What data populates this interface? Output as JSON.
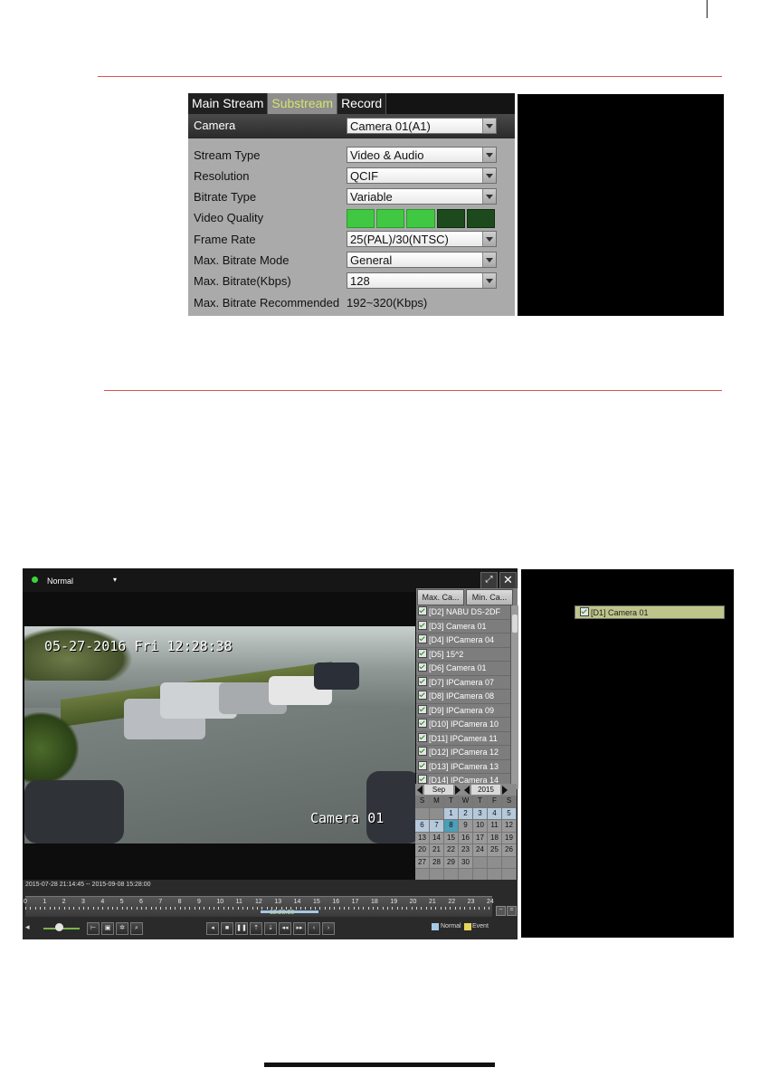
{
  "substream": {
    "tabs": [
      "Main Stream",
      "Substream",
      "Record"
    ],
    "active_tab": "Substream",
    "camera_label": "Camera",
    "camera_value": "Camera 01(A1)",
    "fields": [
      {
        "label": "Stream Type",
        "value": "Video & Audio"
      },
      {
        "label": "Resolution",
        "value": "QCIF"
      },
      {
        "label": "Bitrate Type",
        "value": "Variable"
      },
      {
        "label": "Frame Rate",
        "value": "25(PAL)/30(NTSC)"
      },
      {
        "label": "Max. Bitrate Mode",
        "value": "General"
      },
      {
        "label": "Max. Bitrate(Kbps)",
        "value": "128"
      }
    ],
    "video_quality_label": "Video Quality",
    "video_quality_level": 3,
    "video_quality_max": 5,
    "recommended_label": "Max. Bitrate Recommended",
    "recommended_value": "192~320(Kbps)"
  },
  "playback": {
    "mode": "Normal",
    "osd_datetime": "05-27-2016 Fri 12:28:38",
    "osd_camera": "Camera 01",
    "camera_tabs": [
      "Max. Ca...",
      "Min. Ca..."
    ],
    "cameras": [
      "[D1] Camera 01",
      "[D2] NABU DS-2DF",
      "[D3] Camera 01",
      "[D4] IPCamera 04",
      "[D5] 15^2",
      "[D6] Camera 01",
      "[D7] IPCamera 07",
      "[D8] IPCamera 08",
      "[D9] IPCamera 09",
      "[D10] IPCamera 10",
      "[D11] IPCamera 11",
      "[D12] IPCamera 12",
      "[D13] IPCamera 13",
      "[D14] IPCamera 14"
    ],
    "calendar": {
      "month": "Sep",
      "year": "2015",
      "weekdays": [
        "S",
        "M",
        "T",
        "W",
        "T",
        "F",
        "S"
      ],
      "first_weekday": 2,
      "days": 30,
      "today": 8
    },
    "time_range": "2015-07-28 21:14:45 -- 2015-09-08 15:28:00",
    "cursor_time": "12:28:38",
    "hours": [
      "0",
      "1",
      "2",
      "3",
      "4",
      "5",
      "6",
      "7",
      "8",
      "9",
      "10",
      "11",
      "12",
      "13",
      "14",
      "15",
      "16",
      "17",
      "18",
      "19",
      "20",
      "21",
      "22",
      "23",
      "24"
    ],
    "legend": [
      {
        "name": "Normal",
        "color": "#a5c8e5"
      },
      {
        "name": "Event",
        "color": "#e6d55a"
      }
    ]
  }
}
